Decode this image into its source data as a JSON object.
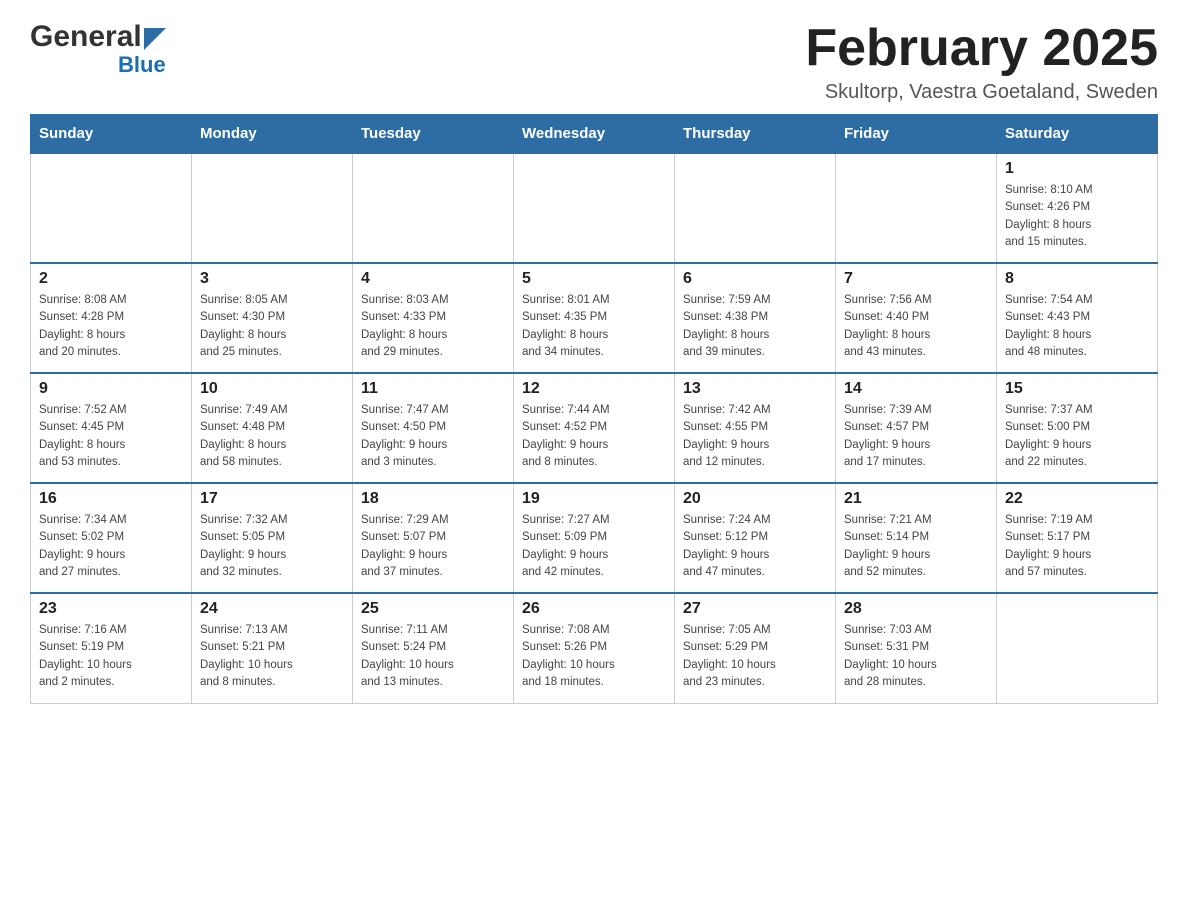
{
  "header": {
    "logo_general": "General",
    "logo_blue": "Blue",
    "month_title": "February 2025",
    "location": "Skultorp, Vaestra Goetaland, Sweden"
  },
  "days_of_week": [
    "Sunday",
    "Monday",
    "Tuesday",
    "Wednesday",
    "Thursday",
    "Friday",
    "Saturday"
  ],
  "weeks": [
    {
      "days": [
        {
          "num": "",
          "info": ""
        },
        {
          "num": "",
          "info": ""
        },
        {
          "num": "",
          "info": ""
        },
        {
          "num": "",
          "info": ""
        },
        {
          "num": "",
          "info": ""
        },
        {
          "num": "",
          "info": ""
        },
        {
          "num": "1",
          "info": "Sunrise: 8:10 AM\nSunset: 4:26 PM\nDaylight: 8 hours\nand 15 minutes."
        }
      ]
    },
    {
      "days": [
        {
          "num": "2",
          "info": "Sunrise: 8:08 AM\nSunset: 4:28 PM\nDaylight: 8 hours\nand 20 minutes."
        },
        {
          "num": "3",
          "info": "Sunrise: 8:05 AM\nSunset: 4:30 PM\nDaylight: 8 hours\nand 25 minutes."
        },
        {
          "num": "4",
          "info": "Sunrise: 8:03 AM\nSunset: 4:33 PM\nDaylight: 8 hours\nand 29 minutes."
        },
        {
          "num": "5",
          "info": "Sunrise: 8:01 AM\nSunset: 4:35 PM\nDaylight: 8 hours\nand 34 minutes."
        },
        {
          "num": "6",
          "info": "Sunrise: 7:59 AM\nSunset: 4:38 PM\nDaylight: 8 hours\nand 39 minutes."
        },
        {
          "num": "7",
          "info": "Sunrise: 7:56 AM\nSunset: 4:40 PM\nDaylight: 8 hours\nand 43 minutes."
        },
        {
          "num": "8",
          "info": "Sunrise: 7:54 AM\nSunset: 4:43 PM\nDaylight: 8 hours\nand 48 minutes."
        }
      ]
    },
    {
      "days": [
        {
          "num": "9",
          "info": "Sunrise: 7:52 AM\nSunset: 4:45 PM\nDaylight: 8 hours\nand 53 minutes."
        },
        {
          "num": "10",
          "info": "Sunrise: 7:49 AM\nSunset: 4:48 PM\nDaylight: 8 hours\nand 58 minutes."
        },
        {
          "num": "11",
          "info": "Sunrise: 7:47 AM\nSunset: 4:50 PM\nDaylight: 9 hours\nand 3 minutes."
        },
        {
          "num": "12",
          "info": "Sunrise: 7:44 AM\nSunset: 4:52 PM\nDaylight: 9 hours\nand 8 minutes."
        },
        {
          "num": "13",
          "info": "Sunrise: 7:42 AM\nSunset: 4:55 PM\nDaylight: 9 hours\nand 12 minutes."
        },
        {
          "num": "14",
          "info": "Sunrise: 7:39 AM\nSunset: 4:57 PM\nDaylight: 9 hours\nand 17 minutes."
        },
        {
          "num": "15",
          "info": "Sunrise: 7:37 AM\nSunset: 5:00 PM\nDaylight: 9 hours\nand 22 minutes."
        }
      ]
    },
    {
      "days": [
        {
          "num": "16",
          "info": "Sunrise: 7:34 AM\nSunset: 5:02 PM\nDaylight: 9 hours\nand 27 minutes."
        },
        {
          "num": "17",
          "info": "Sunrise: 7:32 AM\nSunset: 5:05 PM\nDaylight: 9 hours\nand 32 minutes."
        },
        {
          "num": "18",
          "info": "Sunrise: 7:29 AM\nSunset: 5:07 PM\nDaylight: 9 hours\nand 37 minutes."
        },
        {
          "num": "19",
          "info": "Sunrise: 7:27 AM\nSunset: 5:09 PM\nDaylight: 9 hours\nand 42 minutes."
        },
        {
          "num": "20",
          "info": "Sunrise: 7:24 AM\nSunset: 5:12 PM\nDaylight: 9 hours\nand 47 minutes."
        },
        {
          "num": "21",
          "info": "Sunrise: 7:21 AM\nSunset: 5:14 PM\nDaylight: 9 hours\nand 52 minutes."
        },
        {
          "num": "22",
          "info": "Sunrise: 7:19 AM\nSunset: 5:17 PM\nDaylight: 9 hours\nand 57 minutes."
        }
      ]
    },
    {
      "days": [
        {
          "num": "23",
          "info": "Sunrise: 7:16 AM\nSunset: 5:19 PM\nDaylight: 10 hours\nand 2 minutes."
        },
        {
          "num": "24",
          "info": "Sunrise: 7:13 AM\nSunset: 5:21 PM\nDaylight: 10 hours\nand 8 minutes."
        },
        {
          "num": "25",
          "info": "Sunrise: 7:11 AM\nSunset: 5:24 PM\nDaylight: 10 hours\nand 13 minutes."
        },
        {
          "num": "26",
          "info": "Sunrise: 7:08 AM\nSunset: 5:26 PM\nDaylight: 10 hours\nand 18 minutes."
        },
        {
          "num": "27",
          "info": "Sunrise: 7:05 AM\nSunset: 5:29 PM\nDaylight: 10 hours\nand 23 minutes."
        },
        {
          "num": "28",
          "info": "Sunrise: 7:03 AM\nSunset: 5:31 PM\nDaylight: 10 hours\nand 28 minutes."
        },
        {
          "num": "",
          "info": ""
        }
      ]
    }
  ]
}
